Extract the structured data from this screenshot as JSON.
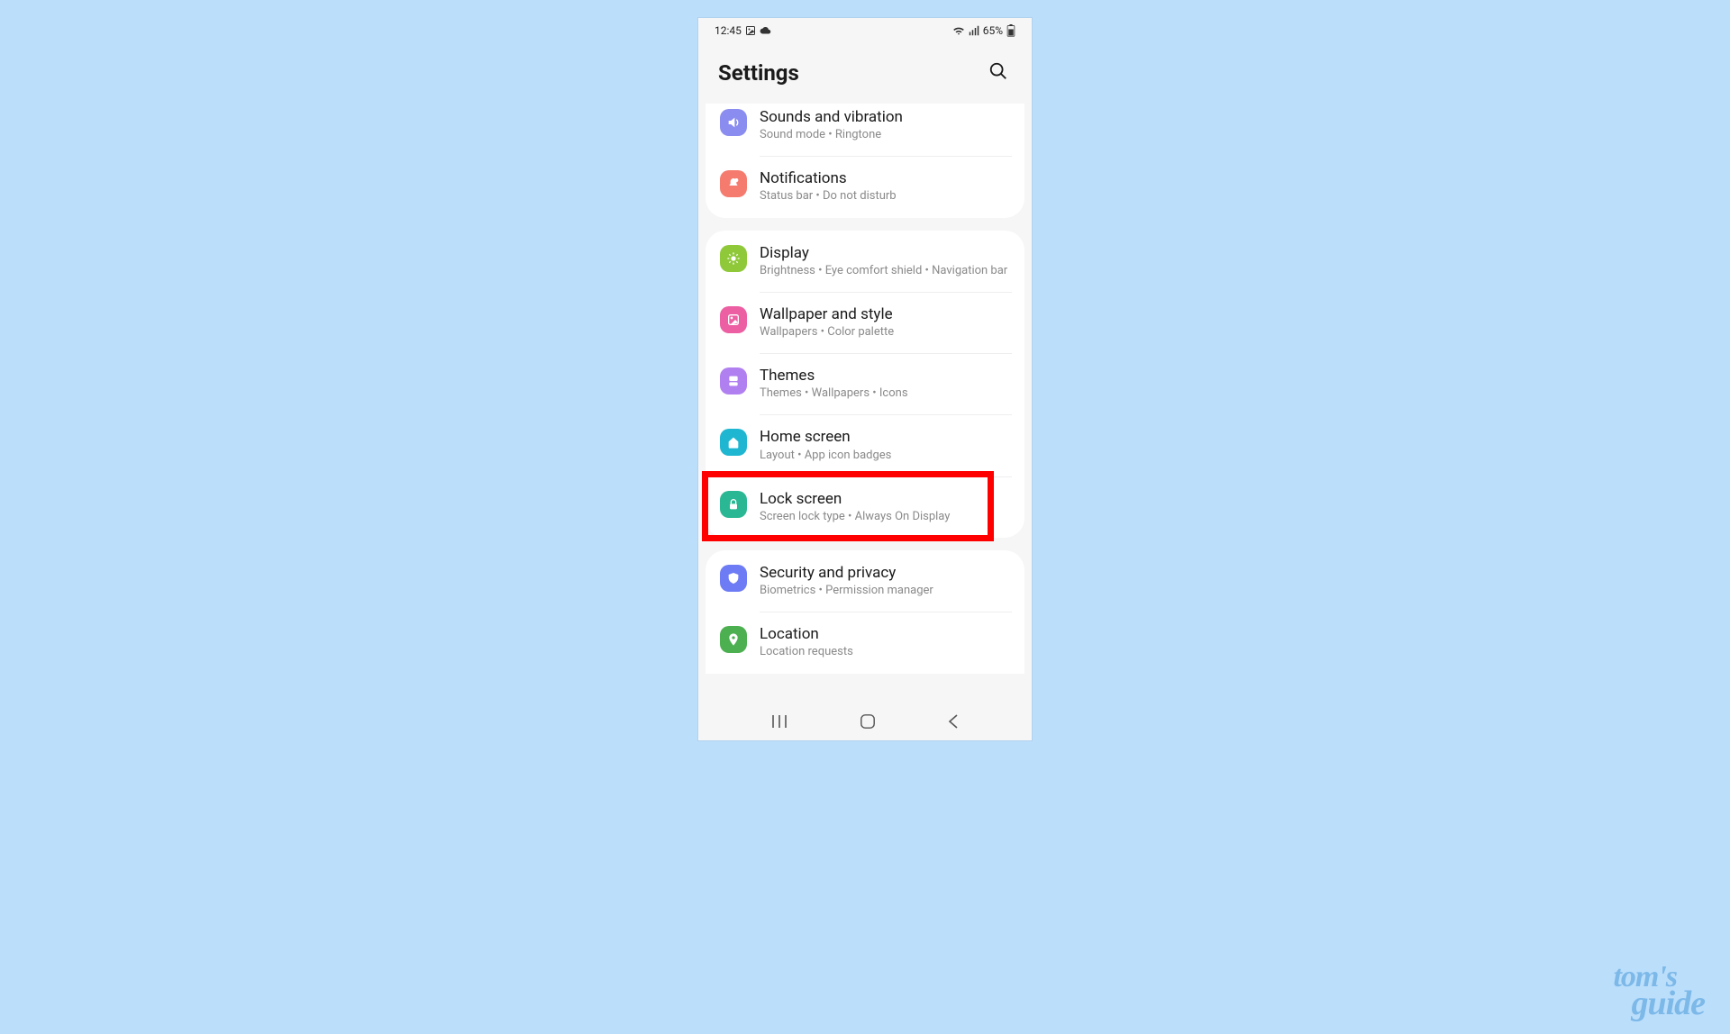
{
  "status": {
    "time": "12:45",
    "battery_text": "65%"
  },
  "header": {
    "title": "Settings"
  },
  "groups": [
    {
      "cut_top": true,
      "items": [
        {
          "id": "sounds",
          "title": "Sounds and vibration",
          "subtitle": "Sound mode  •  Ringtone",
          "icon": "volume",
          "color": "#8a8cf0"
        },
        {
          "id": "notifications",
          "title": "Notifications",
          "subtitle": "Status bar  •  Do not disturb",
          "icon": "bell",
          "color": "#f47b6e"
        }
      ]
    },
    {
      "items": [
        {
          "id": "display",
          "title": "Display",
          "subtitle": "Brightness  •  Eye comfort shield  •  Navigation bar",
          "icon": "sun",
          "color": "#8fc93a"
        },
        {
          "id": "wallpaper",
          "title": "Wallpaper and style",
          "subtitle": "Wallpapers  •  Color palette",
          "icon": "image",
          "color": "#ec5fa2"
        },
        {
          "id": "themes",
          "title": "Themes",
          "subtitle": "Themes  •  Wallpapers  •  Icons",
          "icon": "palette",
          "color": "#b080f0"
        },
        {
          "id": "home",
          "title": "Home screen",
          "subtitle": "Layout  •  App icon badges",
          "icon": "home",
          "color": "#1fb6d1"
        },
        {
          "id": "lock",
          "title": "Lock screen",
          "subtitle": "Screen lock type  •  Always On Display",
          "icon": "lock",
          "color": "#2ab793",
          "highlighted": true
        }
      ]
    },
    {
      "cut_bottom": true,
      "items": [
        {
          "id": "security",
          "title": "Security and privacy",
          "subtitle": "Biometrics  •  Permission manager",
          "icon": "shield",
          "color": "#6d7bf4"
        },
        {
          "id": "location",
          "title": "Location",
          "subtitle": "Location requests",
          "icon": "pin",
          "color": "#4caf50"
        }
      ]
    }
  ],
  "watermark": {
    "line1": "tom's",
    "line2": "guide"
  }
}
